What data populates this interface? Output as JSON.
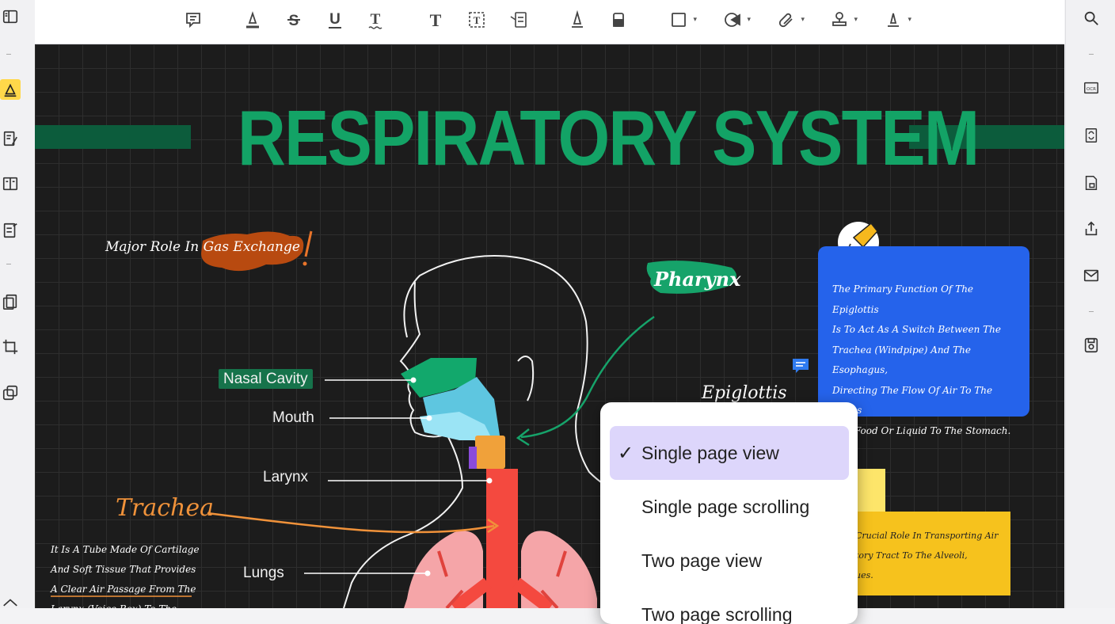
{
  "toolbar": {
    "items": [
      "comment-icon",
      "highlight-icon",
      "strikethrough-icon",
      "underline-icon",
      "squiggly-underline-icon",
      "text-icon",
      "text-box-icon",
      "text-callout-icon",
      "pencil-icon",
      "eraser-icon",
      "shape-icon",
      "area-highlight-icon",
      "attachment-icon",
      "stamp-icon",
      "signature-icon"
    ]
  },
  "canvas": {
    "title": "RESPIRATORY SYSTEM",
    "tagline_prefix": "Major Role In",
    "tagline_highlight": "Gas Exchange",
    "pharynx": "Pharynx",
    "epiglottis": "Epiglottis",
    "labels": {
      "nasal_cavity": "Nasal Cavity",
      "mouth": "Mouth",
      "larynx": "Larynx",
      "trachea": "Trachea",
      "lungs": "Lungs"
    },
    "trachea_note": [
      "It Is A Tube Made Of Cartilage",
      "And Soft Tissue That Provides",
      "A Clear Air Passage From The",
      "Larynx (Voice Box) To The"
    ],
    "blue_note": [
      "The Primary Function Of The Epiglottis",
      "Is To Act As A Switch Between The",
      "Trachea (Windpipe) And The Esophagus,",
      "Directing The Flow Of Air To The Lungs",
      "And Food Or Liquid To The Stomach."
    ],
    "yellow_note": [
      "Crucial Role In Transporting Air",
      "tory Tract To The Alveoli,",
      "ues."
    ]
  },
  "menu": {
    "items": [
      {
        "label": "Single page view",
        "selected": true
      },
      {
        "label": "Single page scrolling",
        "selected": false
      },
      {
        "label": "Two page view",
        "selected": false
      },
      {
        "label": "Two page scrolling",
        "selected": false
      }
    ],
    "check": "✓"
  },
  "colors": {
    "title_green": "#13a366",
    "note_blue": "#2563eb",
    "note_yellow": "#f6c21d",
    "menu_selected": "#ddd6fb",
    "accent_orange": "#f0923a"
  }
}
